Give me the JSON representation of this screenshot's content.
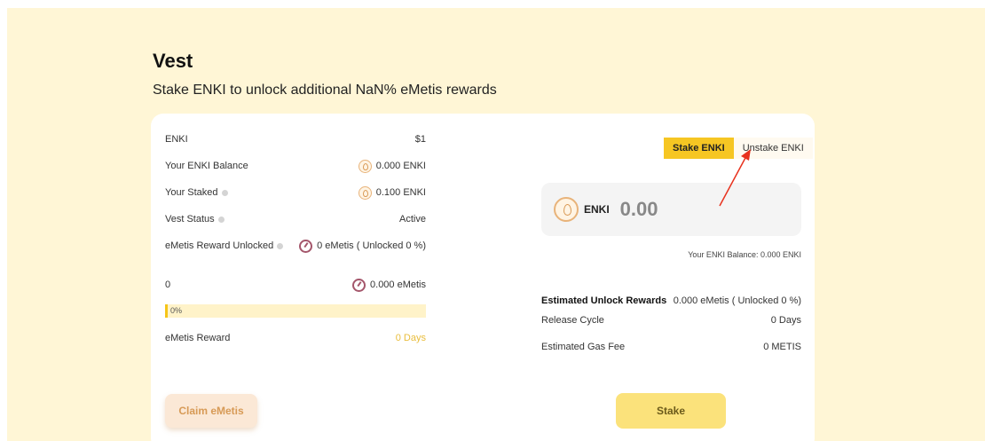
{
  "page": {
    "title": "Vest",
    "subtitle": "Stake ENKI to unlock additional NaN% eMetis rewards"
  },
  "stats": {
    "price_label": "ENKI",
    "price_value": "$1",
    "balance_label": "Your ENKI Balance",
    "balance_value": "0.000 ENKI",
    "staked_label": "Your Staked",
    "staked_value": "0.100 ENKI",
    "status_label": "Vest Status",
    "status_value": "Active",
    "unlocked_label": "eMetis Reward Unlocked",
    "unlocked_value": "0 eMetis ( Unlocked 0 %)",
    "amount_label": "0",
    "amount_value": "0.000 eMetis",
    "progress_text": "0%",
    "progress_fraction": 0.01,
    "reward_label": "eMetis Reward",
    "reward_value": "0 Days"
  },
  "tabs": {
    "stake": "Stake ENKI",
    "unstake": "Unstake ENKI"
  },
  "input": {
    "token": "ENKI",
    "placeholder": "0.00"
  },
  "balance_note": "Your ENKI Balance: 0.000 ENKI",
  "summary": {
    "est_label": "Estimated Unlock Rewards",
    "est_value": "0.000 eMetis ( Unlocked 0 %)",
    "cycle_label": "Release Cycle",
    "cycle_value": "0 Days",
    "gas_label": "Estimated Gas Fee",
    "gas_value": "0 METIS"
  },
  "buttons": {
    "claim": "Claim eMetis",
    "stake": "Stake"
  },
  "colors": {
    "accent": "#f6c623",
    "background": "#fff6d6",
    "arrow": "#e8321e"
  },
  "icons": {
    "enki": "enki-coin-icon",
    "emetis": "emetis-gauge-icon",
    "info": "info-icon"
  }
}
